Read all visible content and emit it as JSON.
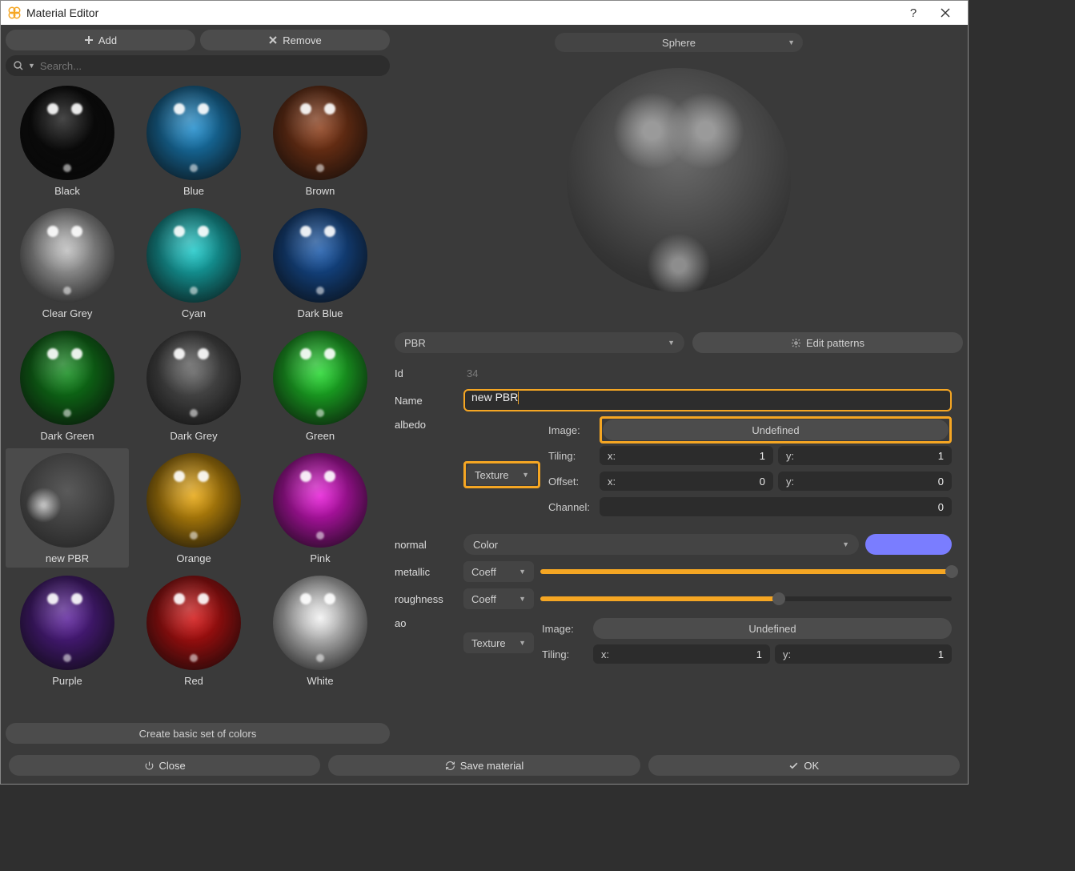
{
  "title": "Material Editor",
  "toolbar": {
    "add": "Add",
    "remove": "Remove"
  },
  "search": {
    "placeholder": "Search..."
  },
  "materials": [
    {
      "name": "Black",
      "color": "#0a0a0a",
      "selected": false
    },
    {
      "name": "Blue",
      "color": "#1a8acb",
      "selected": false
    },
    {
      "name": "Brown",
      "color": "#8a3b17",
      "selected": false
    },
    {
      "name": "Clear Grey",
      "color": "#bdbdbd",
      "selected": false
    },
    {
      "name": "Cyan",
      "color": "#17c7c7",
      "selected": false
    },
    {
      "name": "Dark Blue",
      "color": "#1656a8",
      "selected": false
    },
    {
      "name": "Dark Green",
      "color": "#0f8a1a",
      "selected": false
    },
    {
      "name": "Dark Grey",
      "color": "#5b5b5b",
      "selected": false
    },
    {
      "name": "Green",
      "color": "#1fd62a",
      "selected": false
    },
    {
      "name": "new PBR",
      "color": "#555555",
      "selected": true,
      "pbr": true
    },
    {
      "name": "Orange",
      "color": "#e6a40a",
      "selected": false
    },
    {
      "name": "Pink",
      "color": "#e615d6",
      "selected": false
    },
    {
      "name": "Purple",
      "color": "#5a1f9a",
      "selected": false
    },
    {
      "name": "Red",
      "color": "#d11010",
      "selected": false
    },
    {
      "name": "White",
      "color": "#f2f2f2",
      "selected": false
    }
  ],
  "create_set_label": "Create basic set of colors",
  "preview_shape": "Sphere",
  "type_select": "PBR",
  "edit_patterns": "Edit patterns",
  "id_label": "Id",
  "id_value": "34",
  "name_label": "Name",
  "name_value": "new PBR",
  "albedo": {
    "label": "albedo",
    "mode": "Texture",
    "image_label": "Image:",
    "image_value": "Undefined",
    "tiling_label": "Tiling:",
    "tiling_x": "1",
    "tiling_y": "1",
    "offset_label": "Offset:",
    "offset_x": "0",
    "offset_y": "0",
    "channel_label": "Channel:",
    "channel": "0"
  },
  "normal": {
    "label": "normal",
    "mode": "Color",
    "swatch": "#7a7dff"
  },
  "metallic": {
    "label": "metallic",
    "mode": "Coeff",
    "value": 1.0
  },
  "roughness": {
    "label": "roughness",
    "mode": "Coeff",
    "value": 0.58
  },
  "ao": {
    "label": "ao",
    "mode": "Texture",
    "image_label": "Image:",
    "image_value": "Undefined",
    "tiling_label": "Tiling:",
    "tiling_x": "1",
    "tiling_y": "1"
  },
  "xy": {
    "x": "x:",
    "y": "y:"
  },
  "footer": {
    "close": "Close",
    "save": "Save material",
    "ok": "OK"
  }
}
